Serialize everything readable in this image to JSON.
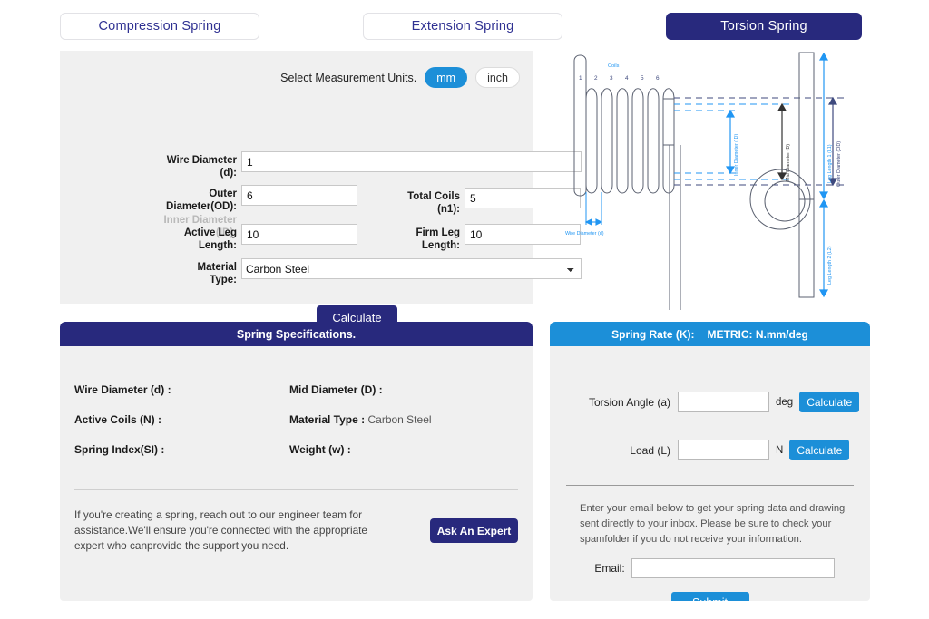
{
  "tabs": [
    {
      "label": "Compression Spring",
      "active": false
    },
    {
      "label": "Extension Spring",
      "active": false
    },
    {
      "label": "Torsion Spring",
      "active": true
    }
  ],
  "form": {
    "units_label": "Select Measurement Units.",
    "unit_mm": "mm",
    "unit_inch": "inch",
    "wire_diameter_label": "Wire Diameter (d):",
    "wire_diameter_value": "1",
    "outer_diameter_label": "Outer Diameter(OD):",
    "inner_diameter_label": "Inner Diameter (ID):",
    "outer_diameter_value": "6",
    "total_coils_label": "Total Coils (n1):",
    "total_coils_value": "5",
    "active_leg_label": "Active Leg Length:",
    "active_leg_value": "10",
    "firm_leg_label": "Firm Leg Length:",
    "firm_leg_value": "10",
    "material_label": "Material Type:",
    "material_value": "Carbon Steel",
    "calculate_label": "Calculate"
  },
  "diagram": {
    "coils_label": "Coils",
    "coil_numbers": [
      "1",
      "2",
      "3",
      "4",
      "5",
      "6"
    ],
    "wire_diameter_label": "Wire Diameter (d)",
    "inner_diameter_label": "Inner Diameter (ID)",
    "mid_diameter_label": "Mid Diameter (D)",
    "outer_diameter_label": "Outer Diameter (OD)",
    "leg_length_1_label": "Leg Length 1 (L1)",
    "leg_length_2_label": "Leg Length 2 (L2)"
  },
  "specs": {
    "title": "Spring Specifications.",
    "items": [
      {
        "label": "Wire Diameter (d) :",
        "value": ""
      },
      {
        "label": "Mid Diameter (D) :",
        "value": ""
      },
      {
        "label": "Active Coils (N) :",
        "value": ""
      },
      {
        "label": "Material Type :",
        "value": "Carbon Steel"
      },
      {
        "label": "Spring Index(SI) :",
        "value": ""
      },
      {
        "label": "Weight (w) :",
        "value": ""
      }
    ],
    "expert_text": "If you're creating a spring, reach out to our engineer team for assistance.We'll ensure you're connected with the appropriate expert who canprovide the support you need.",
    "expert_button": "Ask An Expert"
  },
  "rate": {
    "title": "Spring Rate (K):",
    "units": "METRIC: N.mm/deg",
    "torsion_angle_label": "Torsion Angle (a)",
    "torsion_angle_value": "",
    "torsion_angle_unit": "deg",
    "torsion_calculate_label": "Calculate",
    "load_label": "Load (L)",
    "load_value": "",
    "load_unit": "N",
    "load_calculate_label": "Calculate",
    "email_info": "Enter your email below to get your spring data and drawing sent directly to your inbox. Please be sure to check your spamfolder if you do not receive your information.",
    "email_label": "Email:",
    "email_value": "",
    "submit_label": "Submit"
  },
  "colors": {
    "navy": "#28297d",
    "blue": "#1c8fd8",
    "panel": "#f0f0f0",
    "diagram_blue": "#2196f3",
    "diagram_dark": "#3f4a7e"
  }
}
